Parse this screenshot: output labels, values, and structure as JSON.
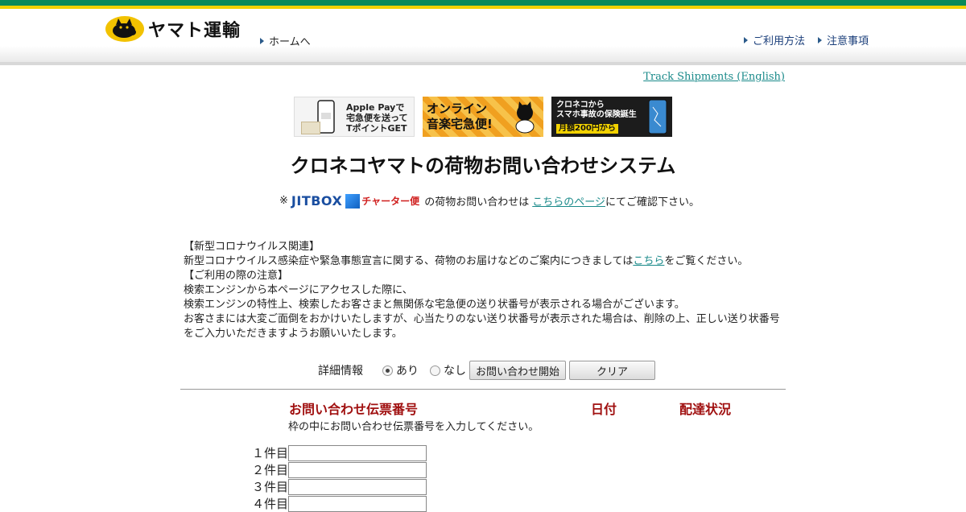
{
  "header": {
    "logo_text": "ヤマト運輸",
    "home_link": "ホームへ",
    "usage_link": "ご利用方法",
    "notes_link": "注意事項"
  },
  "track_english": "Track Shipments (English)",
  "banners": [
    {
      "lines": [
        "Apple Payで",
        "宅急便を送って",
        "TポイントGET"
      ]
    },
    {
      "lines": [
        "オンライン",
        "音楽宅急便!"
      ]
    },
    {
      "lines": [
        "クロネコから",
        "スマホ事故の保険誕生",
        "月額200円から"
      ]
    }
  ],
  "title": "クロネコヤマトの荷物お問い合わせシステム",
  "jitbox": {
    "prefix": "※",
    "logo": "JITBOX",
    "charter": "チャーター便",
    "text_before": "の荷物お問い合わせは",
    "link": "こちらのページ",
    "text_after": "にてご確認下さい。"
  },
  "notice": {
    "covid_heading": "【新型コロナウイルス関連】",
    "covid_text_before": "新型コロナウイルス感染症や緊急事態宣言に関する、荷物のお届けなどのご案内につきましては",
    "covid_link": "こちら",
    "covid_text_after": "をご覧ください。",
    "caution_heading": "【ご利用の際の注意】",
    "line1": "検索エンジンから本ページにアクセスした際に、",
    "line2": "検索エンジンの特性上、検索したお客さまと無関係な宅急便の送り状番号が表示される場合がございます。",
    "line3": "お客さまには大変ご面倒をおかけいたしますが、心当たりのない送り状番号が表示された場合は、削除の上、正しい送り状番号",
    "line4": "をご入力いただきますようお願いいたします。"
  },
  "controls": {
    "detail_label": "詳細情報",
    "option_yes": "あり",
    "option_no": "なし",
    "selected": "あり",
    "start_button": "お問い合わせ開始",
    "clear_button": "クリア"
  },
  "table": {
    "col_number": "お問い合わせ伝票番号",
    "col_date": "日付",
    "col_status": "配達状況",
    "hint": "枠の中にお問い合わせ伝票番号を入力してください。",
    "rows": [
      {
        "label": "１件目",
        "value": ""
      },
      {
        "label": "２件目",
        "value": ""
      },
      {
        "label": "３件目",
        "value": ""
      },
      {
        "label": "４件目",
        "value": ""
      }
    ]
  },
  "colors": {
    "green": "#0b8a5a",
    "yellow": "#f2d200",
    "heading_red": "#a01010",
    "link_teal": "#1a8a8a"
  }
}
